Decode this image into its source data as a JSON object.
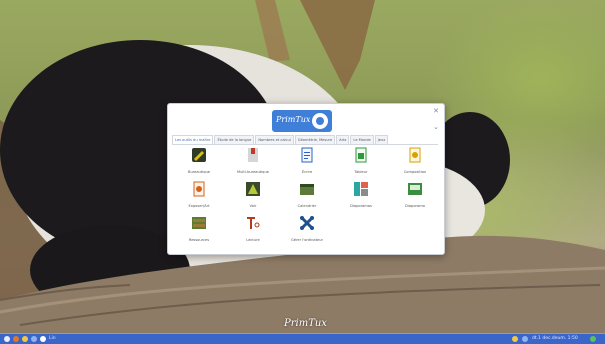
{
  "window": {
    "logo_text": "PrimTux",
    "tabs": [
      "Les outils du maître",
      "Étude de la langue",
      "Nombres et calcul",
      "Géométrie, Mesure",
      "Arts",
      "Le Monde",
      "Jeux"
    ],
    "apps": [
      {
        "label": "Bureautique",
        "icon": "pen-icon",
        "color": "#d8b400"
      },
      {
        "label": "Multi-bureautique",
        "icon": "document-gray-icon",
        "color": "#c9c9c9"
      },
      {
        "label": "Écrire",
        "icon": "writer-icon",
        "color": "#2a63c4"
      },
      {
        "label": "Tableur",
        "icon": "calc-icon",
        "color": "#2d9a3b"
      },
      {
        "label": "Composition",
        "icon": "layout-icon",
        "color": "#d9a200"
      },
      {
        "label": "Exposer/Art",
        "icon": "palette-icon",
        "color": "#d0641c"
      },
      {
        "label": "Voir",
        "icon": "image-viewer-icon",
        "color": "#6a8d1d"
      },
      {
        "label": "Calendrier",
        "icon": "calendar-icon",
        "color": "#4a8c3a"
      },
      {
        "label": "Diaporamas",
        "icon": "slides-icon",
        "color": "#2aa6a3"
      },
      {
        "label": "Diaporama",
        "icon": "presentation-icon",
        "color": "#3d8d40"
      },
      {
        "label": "Ressources",
        "icon": "cabinet-icon",
        "color": "#5b7d2d"
      },
      {
        "label": "Lecture",
        "icon": "scissors-icon",
        "color": "#b33a1c"
      },
      {
        "label": "Gérer l'ordinateur",
        "icon": "network-icon",
        "color": "#1f4f8f"
      }
    ]
  },
  "desktop": {
    "logo_text": "PrimTux"
  },
  "taskbar": {
    "start_label": "Lin",
    "clock": "dt.1 dec.deum. 1:50"
  }
}
